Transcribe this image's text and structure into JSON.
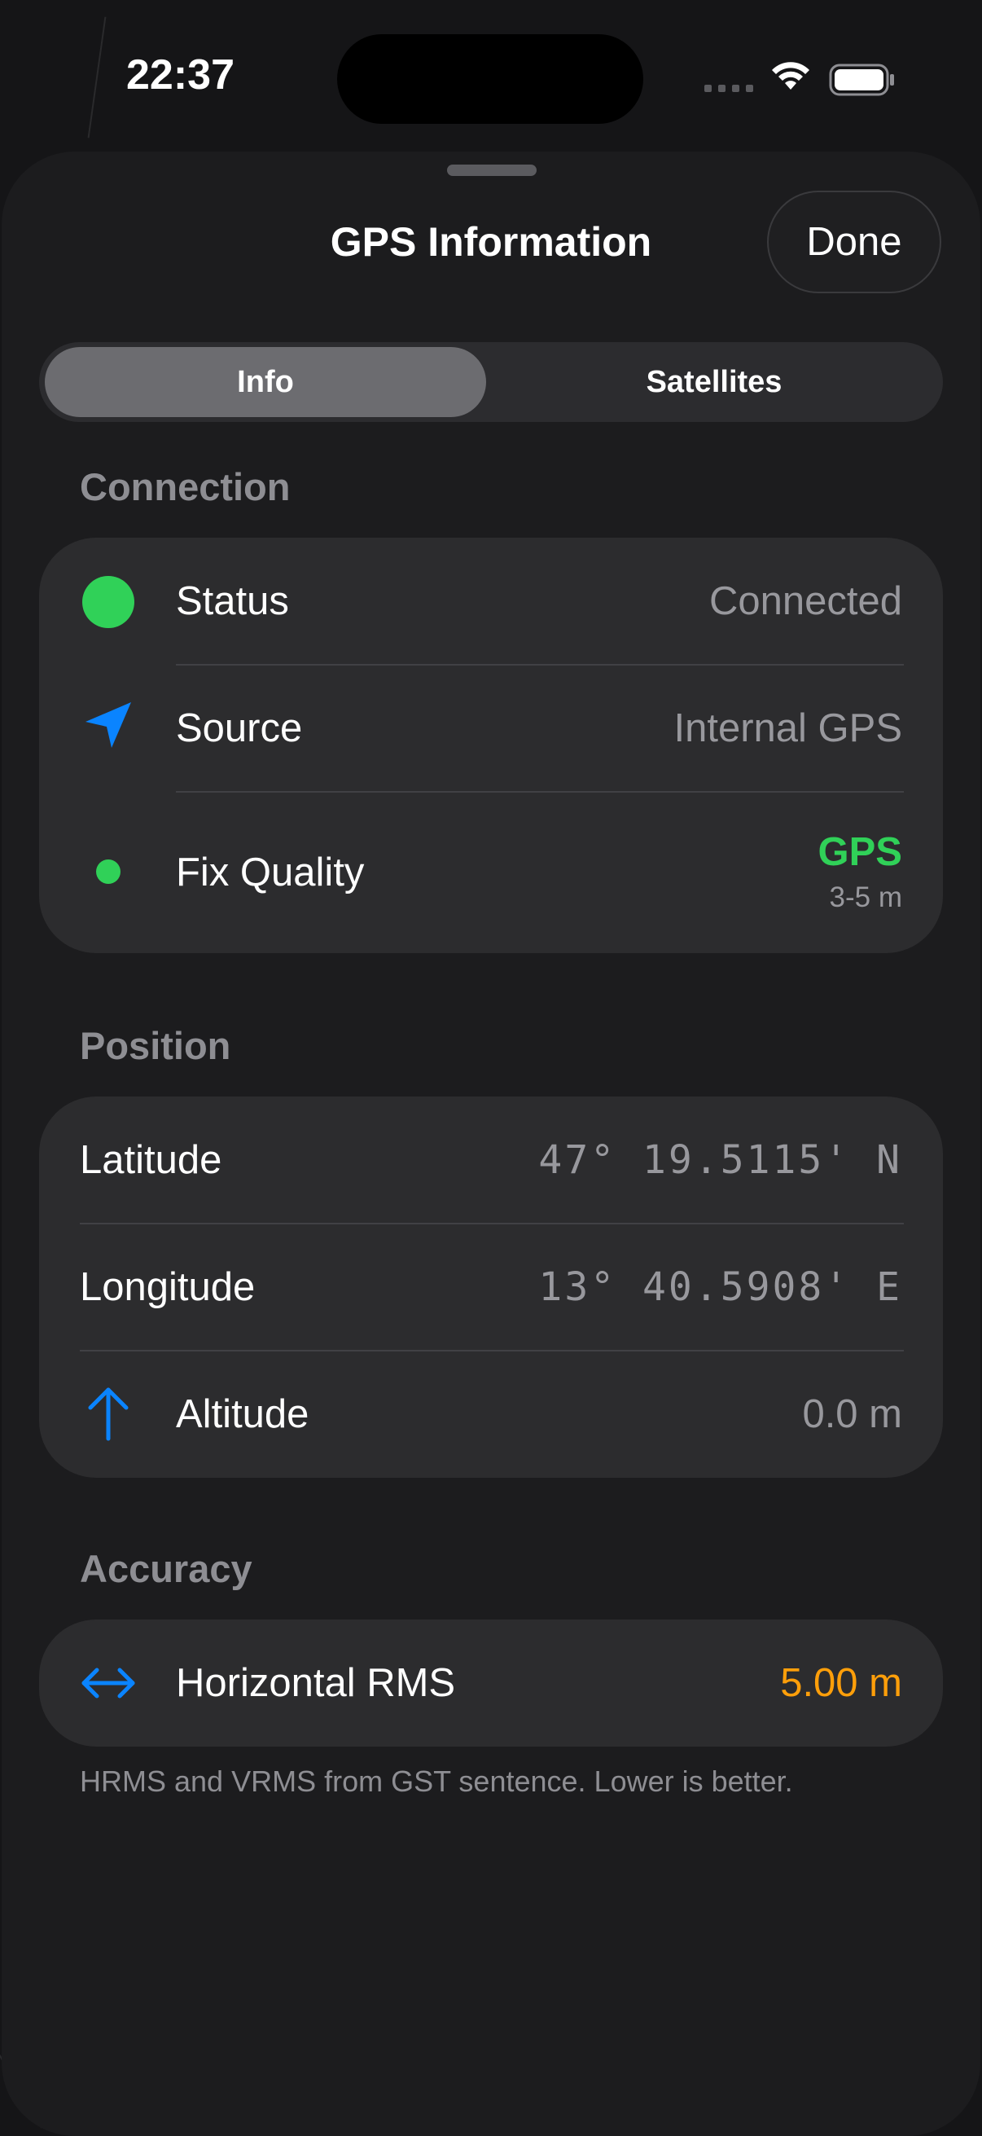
{
  "status_bar": {
    "time": "22:37"
  },
  "sheet": {
    "title": "GPS Information",
    "done_label": "Done"
  },
  "tabs": [
    {
      "label": "Info",
      "selected": true
    },
    {
      "label": "Satellites",
      "selected": false
    }
  ],
  "connection": {
    "header": "Connection",
    "status": {
      "label": "Status",
      "value": "Connected",
      "icon": "green-circle-icon"
    },
    "source": {
      "label": "Source",
      "value": "Internal GPS",
      "icon": "location-arrow-icon"
    },
    "fix_quality": {
      "label": "Fix Quality",
      "value": "GPS",
      "sub_value": "3-5 m",
      "icon": "green-dot-icon"
    }
  },
  "position": {
    "header": "Position",
    "latitude": {
      "label": "Latitude",
      "value": "47° 19.5115' N"
    },
    "longitude": {
      "label": "Longitude",
      "value": "13° 40.5908' E"
    },
    "altitude": {
      "label": "Altitude",
      "value": "0.0 m",
      "icon": "arrow-up-icon"
    }
  },
  "accuracy": {
    "header": "Accuracy",
    "horizontal_rms": {
      "label": "Horizontal RMS",
      "value": "5.00 m",
      "icon": "horizontal-arrows-icon"
    },
    "footnote": "HRMS and VRMS from GST sentence. Lower is better."
  },
  "colors": {
    "accent_blue": "#0a84ff",
    "status_green": "#30d158",
    "warning_orange": "#ff9f0a",
    "card_bg": "#2c2c2e",
    "sheet_bg": "#1c1c1e"
  }
}
